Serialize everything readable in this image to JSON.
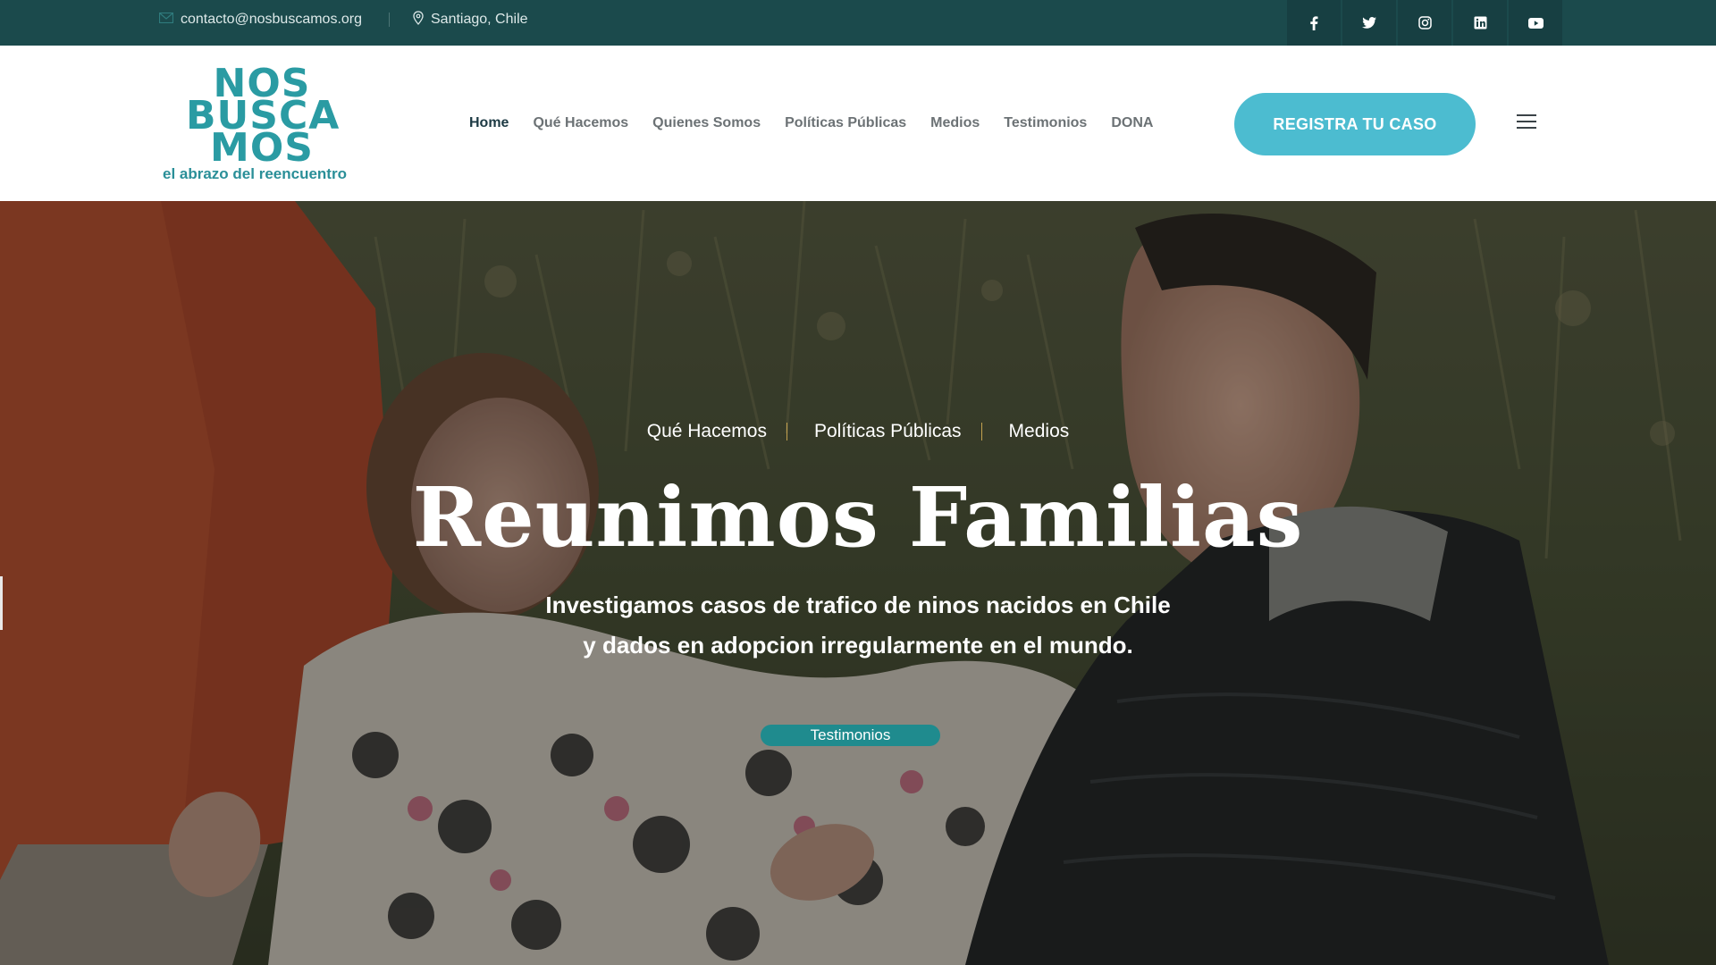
{
  "topbar": {
    "email": "contacto@nosbuscamos.org",
    "location": "Santiago, Chile",
    "icons": {
      "email": "mail-icon",
      "location": "map-pin-icon"
    },
    "social": [
      {
        "name": "facebook-icon",
        "glyph": "f"
      },
      {
        "name": "twitter-icon",
        "glyph": "t"
      },
      {
        "name": "instagram-icon",
        "glyph": "ig"
      },
      {
        "name": "linkedin-icon",
        "glyph": "in"
      },
      {
        "name": "youtube-icon",
        "glyph": "yt"
      }
    ]
  },
  "header": {
    "logo": {
      "line1": "NOS",
      "line2": "BUSCA",
      "line3": "MOS",
      "tagline": "el abrazo del reencuentro"
    },
    "nav": [
      {
        "label": "Home",
        "active": true
      },
      {
        "label": "Qué Hacemos"
      },
      {
        "label": "Quienes Somos"
      },
      {
        "label": "Políticas Públicas"
      },
      {
        "label": "Medios"
      },
      {
        "label": "Testimonios"
      },
      {
        "label": "DONA"
      }
    ],
    "cta_label": "REGISTRA TU CASO",
    "menu_icon": "hamburger-menu-icon"
  },
  "hero": {
    "breadcrumbs": [
      "Qué Hacemos",
      "Políticas Públicas",
      "Medios"
    ],
    "title": "Reunimos Familias",
    "subtitle_line1": "Investigamos casos de trafico de ninos nacidos en Chile",
    "subtitle_line2": "y dados en adopcion irregularmente en el mundo.",
    "button_label": "Testimonios"
  },
  "colors": {
    "topbar": "#1b4a4c",
    "brand": "#2a9ba3",
    "cta": "#4cbcd0",
    "hero_button": "#1f8b8e"
  }
}
